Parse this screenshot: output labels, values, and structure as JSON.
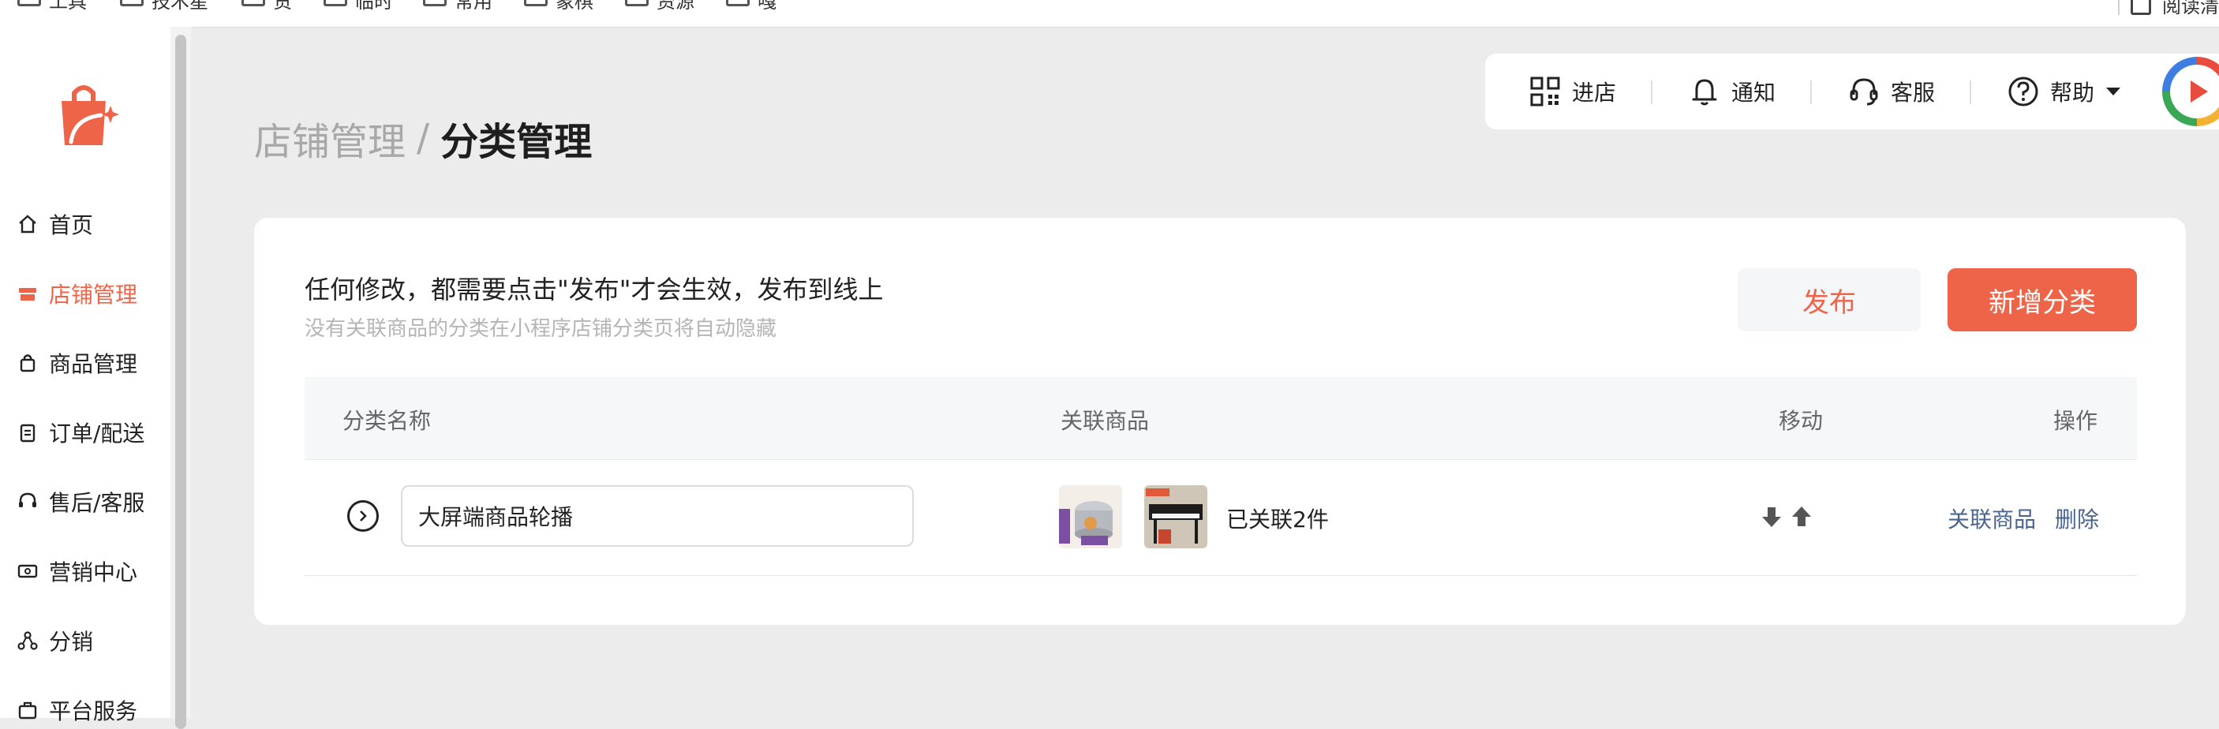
{
  "bookmarks": {
    "items": [
      {
        "label": "工具"
      },
      {
        "label": "技术星"
      },
      {
        "label": "货"
      },
      {
        "label": "临时"
      },
      {
        "label": "常用"
      },
      {
        "label": "象棋"
      },
      {
        "label": "资源"
      },
      {
        "label": "嘎"
      }
    ],
    "right_label": "阅读清"
  },
  "sidebar": {
    "items": [
      {
        "label": "首页",
        "icon": "home-icon"
      },
      {
        "label": "店铺管理",
        "icon": "store-icon",
        "active": true
      },
      {
        "label": "商品管理",
        "icon": "bag-icon"
      },
      {
        "label": "订单/配送",
        "icon": "clipboard-icon"
      },
      {
        "label": "售后/客服",
        "icon": "headset-icon"
      },
      {
        "label": "营销中心",
        "icon": "ticket-icon"
      },
      {
        "label": "分销",
        "icon": "share-icon"
      },
      {
        "label": "平台服务",
        "icon": "briefcase-icon"
      }
    ]
  },
  "breadcrumb": {
    "parent": "店铺管理",
    "separator": "/",
    "current": "分类管理"
  },
  "topbar": {
    "enter_store": "进店",
    "notifications": "通知",
    "support": "客服",
    "help": "帮助"
  },
  "card": {
    "notice": "任何修改，都需要点击\"发布\"才会生效，发布到线上",
    "subnotice": "没有关联商品的分类在小程序店铺分类页将自动隐藏",
    "publish_label": "发布",
    "add_label": "新增分类"
  },
  "table": {
    "headers": {
      "name": "分类名称",
      "products": "关联商品",
      "move": "移动",
      "actions": "操作"
    },
    "rows": [
      {
        "name": "大屏端商品轮播",
        "linked_text": "已关联2件",
        "link_action": "关联商品",
        "delete_action": "删除"
      }
    ]
  },
  "colors": {
    "accent": "#ee6448",
    "link": "#4a6590"
  }
}
